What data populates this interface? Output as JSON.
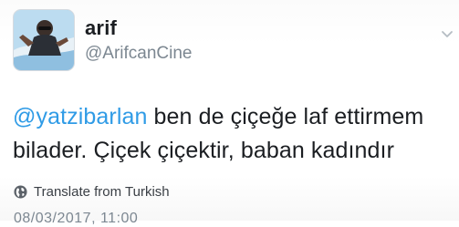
{
  "tweet": {
    "display_name": "arif",
    "username": "@ArifcanCine",
    "mention": "@yatzibarlan",
    "text_after_mention": " ben de çiçeğe laf ettirmem",
    "text_line2": "bilader. Çiçek çiçektir, baban kadındır",
    "translate_label": "Translate from Turkish",
    "timestamp": "08/03/2017, 11:00"
  },
  "colors": {
    "mention": "#2f9be6",
    "secondary_text": "#7c8791",
    "primary_text": "#1b1e22"
  },
  "icons": {
    "globe": "globe-icon",
    "chevron": "chevron-down-icon"
  }
}
